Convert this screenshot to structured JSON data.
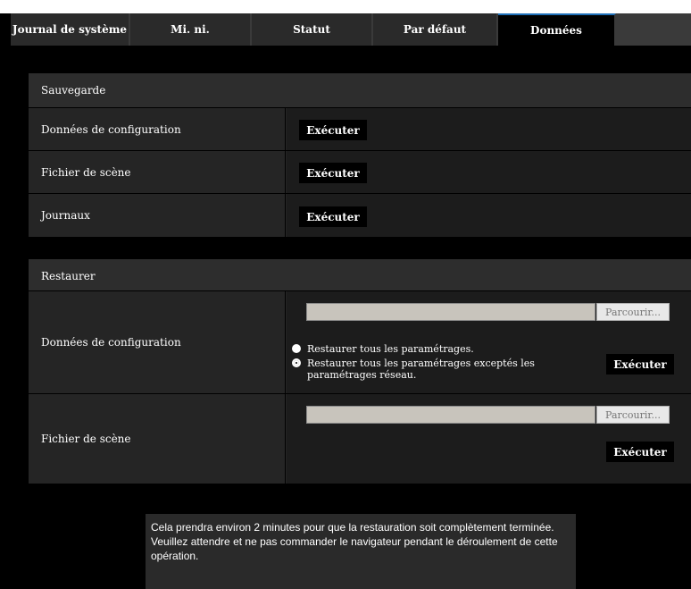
{
  "tabs": [
    {
      "label": "Journal de système"
    },
    {
      "label": "Mi. ni."
    },
    {
      "label": "Statut"
    },
    {
      "label": "Par défaut"
    },
    {
      "label": "Données",
      "active": true
    }
  ],
  "backup": {
    "title": "Sauvegarde",
    "rows": [
      {
        "label": "Données de configuration",
        "button": "Exécuter"
      },
      {
        "label": "Fichier de scène",
        "button": "Exécuter"
      },
      {
        "label": "Journaux",
        "button": "Exécuter"
      }
    ]
  },
  "restore": {
    "title": "Restaurer",
    "config": {
      "label": "Données de configuration",
      "file_value": "",
      "browse": "Parcourir...",
      "option_all": "Restaurer tous les paramétrages.",
      "option_except": "Restaurer tous les paramétrages exceptés les paramétrages réseau.",
      "selected": "except",
      "button": "Exécuter"
    },
    "scene": {
      "label": "Fichier de scène",
      "file_value": "",
      "browse": "Parcourir...",
      "button": "Exécuter"
    }
  },
  "notice": {
    "line1": "Cela prendra environ 2 minutes pour que la restauration soit complètement terminée.",
    "line2": "Veuillez attendre et ne pas commander le navigateur pendant le déroulement de cette opération."
  },
  "colors": {
    "active_tab_accent": "#1e6fb8",
    "background": "#000000"
  }
}
